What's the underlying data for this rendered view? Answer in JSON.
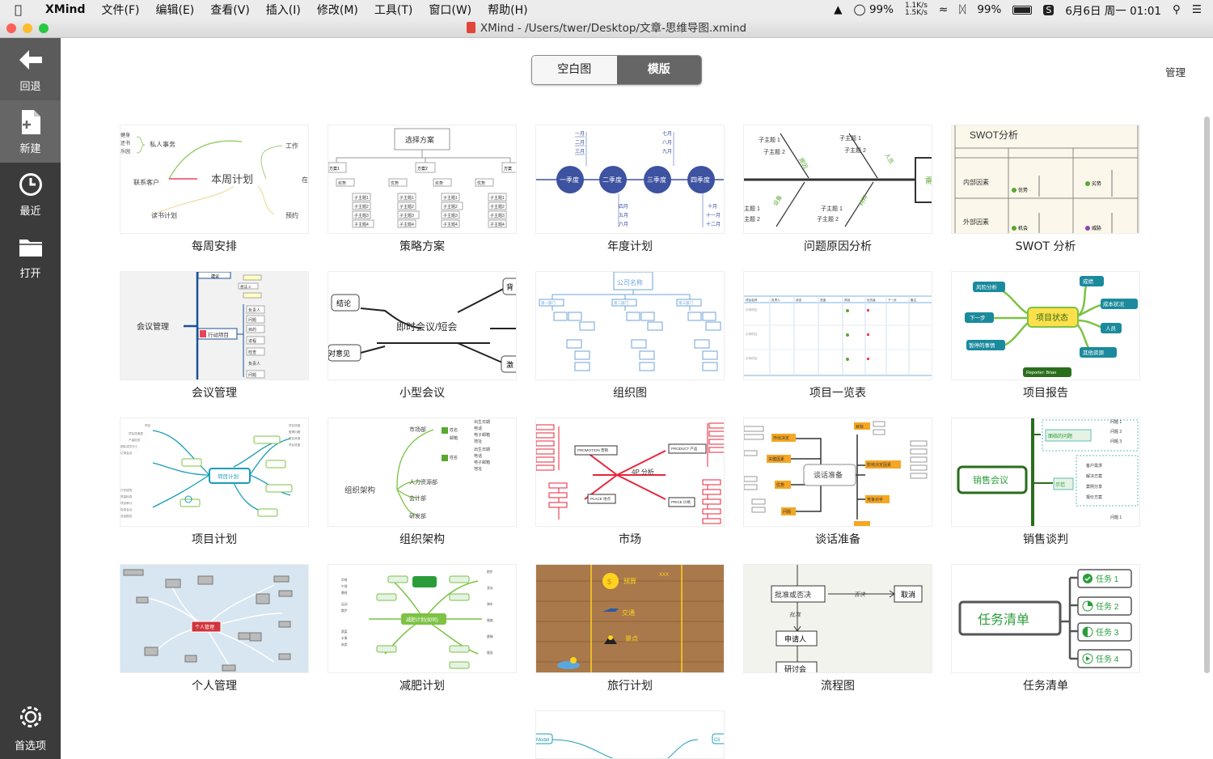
{
  "menubar": {
    "app": "XMind",
    "items": [
      "文件(F)",
      "编辑(E)",
      "查看(V)",
      "插入(I)",
      "修改(M)",
      "工具(T)",
      "窗口(W)",
      "帮助(H)"
    ],
    "cpu": "99%",
    "net_up": "1.1K/s",
    "net_down": "1.5K/s",
    "battery": "99%",
    "datetime": "6月6日 周一 01:01"
  },
  "window": {
    "title": "XMind - /Users/twer/Desktop/文章-思维导图.xmind"
  },
  "sidebar": {
    "items": [
      {
        "label": "回退",
        "icon": "back-arrow-icon"
      },
      {
        "label": "新建",
        "icon": "new-document-icon"
      },
      {
        "label": "最近",
        "icon": "clock-icon"
      },
      {
        "label": "打开",
        "icon": "folder-icon"
      }
    ],
    "settings_label": "首选项"
  },
  "tabs": {
    "blank": "空白图",
    "templates": "模版"
  },
  "manage_label": "管理",
  "templates": [
    {
      "label": "每周安排"
    },
    {
      "label": "策略方案"
    },
    {
      "label": "年度计划"
    },
    {
      "label": "问题原因分析"
    },
    {
      "label": "SWOT 分析"
    },
    {
      "label": "会议管理"
    },
    {
      "label": "小型会议"
    },
    {
      "label": "组织图"
    },
    {
      "label": "项目一览表"
    },
    {
      "label": "项目报告"
    },
    {
      "label": "项目计划"
    },
    {
      "label": "组织架构"
    },
    {
      "label": "市场"
    },
    {
      "label": "谈话准备"
    },
    {
      "label": "销售谈判"
    },
    {
      "label": "个人管理"
    },
    {
      "label": "减肥计划"
    },
    {
      "label": "旅行计划"
    },
    {
      "label": "流程图"
    },
    {
      "label": "任务清单"
    }
  ],
  "thumbs": {
    "weekly": {
      "center": "本周计划",
      "b1": "私人事务",
      "b2": "联系客户",
      "b3": "读书计划",
      "b4": "工作",
      "b5": "在",
      "b6": "预约",
      "side": "健身\n还书\n乐园"
    },
    "strategy": {
      "top": "选择方案",
      "a": "方案1",
      "b": "方案2",
      "c": "方案",
      "sub": "子主题1",
      "sub2": "子主题2",
      "sub3": "子主题3",
      "sub4": "子主题4",
      "pro": "优势",
      "con": "劣势"
    },
    "annual": {
      "q1": "一季度",
      "q2": "二季度",
      "q3": "三季度",
      "q4": "四季度",
      "m1": "一月",
      "m2": "二月",
      "m3": "三月",
      "m4": "四月",
      "m5": "五月",
      "m6": "六月",
      "m7": "七月",
      "m8": "八月",
      "m9": "九月",
      "m10": "十月",
      "m11": "十一月",
      "m12": "十二月"
    },
    "fishbone": {
      "t1": "子主题 1",
      "t2": "子主题 2",
      "head": "需"
    },
    "swot": {
      "title": "SWOT分析",
      "internal": "内部因素",
      "external": "外部因素",
      "s": "优势",
      "w": "劣势",
      "o": "机会",
      "t": "威胁"
    },
    "meeting": {
      "center": "会议管理",
      "action": "行动项目",
      "suggest": "建议",
      "person": "负责人",
      "problem": "问题",
      "goal": "目的",
      "process": "进程",
      "check": "检查",
      "topic": "问题"
    },
    "small": {
      "center": "即时会议/短会",
      "a": "结论",
      "b": "对意见",
      "c": "背",
      "d": "激"
    },
    "org": {
      "top": "公司名称",
      "d1": "第一部门",
      "d2": "第二部门",
      "d3": "第三部门"
    },
    "report": {
      "center": "项目状态",
      "a": "风险分析",
      "b": "下一步",
      "c": "暂停的事情",
      "d": "成绩",
      "e": "成本状况",
      "f": "人员",
      "g": "其他资源",
      "rep": "Reporter: Brian"
    },
    "plan": {
      "center": "项目计划"
    },
    "structure": {
      "center": "组织架构",
      "a": "市场部",
      "b": "人力资源部",
      "c": "会计部",
      "d": "研发部",
      "e": "销售",
      "f": "电话",
      "g": "电子邮箱",
      "h": "地址",
      "i": "出生日期"
    },
    "market": {
      "center": "4P 分析",
      "a": "PROMOTION 营销",
      "b": "PRODUCT 产品",
      "c": "PLACE 地点",
      "d": "PRICE 价格"
    },
    "talk": {
      "center": "谈话准备",
      "a": "作出决定",
      "b": "关键因素",
      "c": "优势",
      "d": "问题",
      "e": "影响决定因素",
      "f": "竞争对手",
      "g": "目标"
    },
    "sales": {
      "center": "销售会议",
      "a": "面临的问题",
      "b": "示范",
      "c": "问题 1",
      "d": "问题 2",
      "e": "问题 3",
      "f": "客户需求",
      "g": "解决方案",
      "h": "案例分享",
      "i": "报价方案"
    },
    "personal": {
      "center": "个人管理"
    },
    "diet": {
      "center": "减肥计划(如何)"
    },
    "travel": {
      "a": "预算",
      "b": "交通",
      "c": "景点",
      "d": "XXX"
    },
    "flow": {
      "a": "批准或否决",
      "b": "否决",
      "c": "取消",
      "d": "批准",
      "e": "申请人",
      "f": "研讨会"
    },
    "tasks": {
      "center": "任务清单",
      "t1": "任务 1",
      "t2": "任务 2",
      "t3": "任务 3",
      "t4": "任务 4"
    },
    "partial": {
      "a": "Model",
      "b": "Cli"
    }
  },
  "colors": {
    "sidebar": "#3b3b3b",
    "accent_green": "#5aa732",
    "annual_blue": "#3d52a0"
  }
}
